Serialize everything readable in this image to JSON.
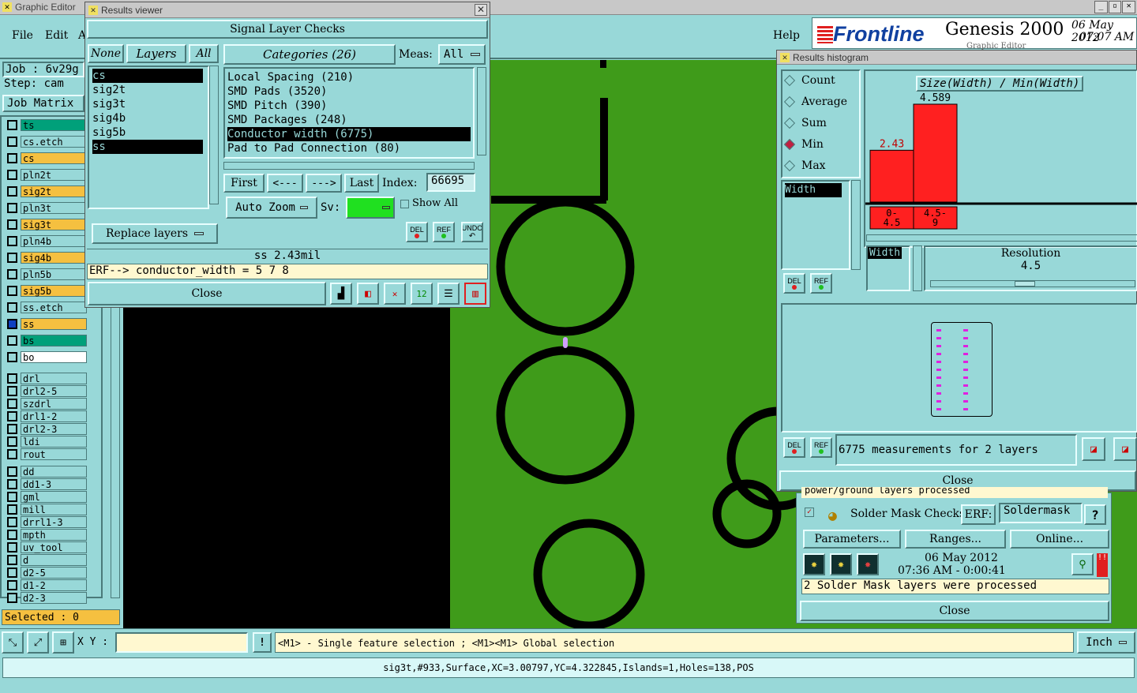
{
  "app": {
    "title": "Graphic Editor",
    "menu": [
      "File",
      "Edit",
      "A"
    ],
    "help": "Help"
  },
  "brand": {
    "logo": "Frontline",
    "product": "Genesis 2000",
    "date": "06 May 2012",
    "time": "07:07 AM",
    "sub": "Graphic Editor"
  },
  "job": {
    "job_label": "Job : 6v29g",
    "step_label": "Step: cam",
    "job_matrix": "Job Matrix"
  },
  "layers": [
    {
      "name": "ts",
      "color": "green"
    },
    {
      "name": "cs.etch",
      "color": "teal"
    },
    {
      "name": "cs",
      "color": "yellow"
    },
    {
      "name": "pln2t",
      "color": "teal"
    },
    {
      "name": "sig2t",
      "color": "yellow"
    },
    {
      "name": "pln3t",
      "color": "teal"
    },
    {
      "name": "sig3t",
      "color": "yellow"
    },
    {
      "name": "pln4b",
      "color": "teal"
    },
    {
      "name": "sig4b",
      "color": "yellow"
    },
    {
      "name": "pln5b",
      "color": "teal"
    },
    {
      "name": "sig5b",
      "color": "yellow"
    },
    {
      "name": "ss.etch",
      "color": "teal"
    },
    {
      "name": "ss",
      "color": "yellow"
    },
    {
      "name": "bs",
      "color": "green"
    },
    {
      "name": "bo",
      "color": "white"
    },
    {
      "name": "drl",
      "color": "teal"
    },
    {
      "name": "drl2-5",
      "color": "teal"
    },
    {
      "name": "szdrl",
      "color": "teal"
    },
    {
      "name": "drl1-2",
      "color": "teal"
    },
    {
      "name": "drl2-3",
      "color": "teal"
    },
    {
      "name": "ldi",
      "color": "teal"
    },
    {
      "name": "rout",
      "color": "teal"
    },
    {
      "name": "dd",
      "color": "teal"
    },
    {
      "name": "dd1-3",
      "color": "teal"
    },
    {
      "name": "gml",
      "color": "teal"
    },
    {
      "name": "mill",
      "color": "teal"
    },
    {
      "name": "drrl1-3",
      "color": "teal"
    },
    {
      "name": "mpth",
      "color": "teal"
    },
    {
      "name": "uv_tool",
      "color": "teal"
    },
    {
      "name": "d",
      "color": "teal"
    },
    {
      "name": "d2-5",
      "color": "teal"
    },
    {
      "name": "d1-2",
      "color": "teal"
    },
    {
      "name": "d2-3",
      "color": "teal"
    }
  ],
  "selected": "Selected : 0",
  "results_viewer": {
    "title": "Results viewer",
    "header": "Signal Layer Checks",
    "none": "None",
    "layers_tab": "Layers",
    "all": "All",
    "layer_list": [
      "cs",
      "sig2t",
      "sig3t",
      "sig4b",
      "sig5b",
      "ss"
    ],
    "categories_label": "Categories (26)",
    "meas_label": "Meas:",
    "meas_value": "All",
    "categories": [
      "Local Spacing (210)",
      "SMD Pads (3520)",
      "SMD Pitch (390)",
      "SMD Packages (248)",
      "Conductor width (6775)",
      "Pad to Pad Connection (80)"
    ],
    "first": "First",
    "prev": "<---",
    "next": "--->",
    "last": "Last",
    "index_label": "Index:",
    "index_value": "66695",
    "autozoom": "Auto Zoom",
    "sv": "Sv:",
    "show_all": "Show All",
    "replace": "Replace layers",
    "del": "DEL",
    "ref": "REF",
    "undo": "UNDO",
    "status": "ss 2.43mil",
    "erf": "ERF--> conductor_width = 5 7 8",
    "close": "Close"
  },
  "histogram": {
    "title": "Results histogram",
    "options": [
      "Count",
      "Average",
      "Sum",
      "Min",
      "Max"
    ],
    "selected_option": "Min",
    "chart_title": "Size(Width) / Min(Width)",
    "chart_data": {
      "type": "bar",
      "categories": [
        "0-4.5",
        "4.5-9"
      ],
      "values": [
        2.43,
        4.589
      ],
      "title": "Size(Width) / Min(Width)"
    },
    "bar_labels": [
      "2.43",
      "4.589"
    ],
    "bin_labels": [
      "0-\n4.5",
      "4.5-\n9"
    ],
    "list_item": "Width",
    "width_label": "Width",
    "resolution_label": "Resolution",
    "resolution_value": "4.5",
    "measurements": "6775 measurements for 2 layers",
    "close": "Close",
    "accent": "#ff2020"
  },
  "solder": {
    "partial": "power/ground layers processed",
    "title": "Solder Mask Checks",
    "erf": "ERF:",
    "erf_value": "Soldermask",
    "help": "?",
    "parameters": "Parameters...",
    "ranges": "Ranges...",
    "online": "Online...",
    "date": "06 May 2012",
    "time": "07:36 AM - 0:00:41",
    "status": "2 Solder Mask layers were processed",
    "close": "Close"
  },
  "bottom": {
    "xy": "X Y :",
    "hint": "<M1> - Single feature selection ; <M1><M1> Global selection",
    "units": "Inch",
    "status": "sig3t,#933,Surface,XC=3.00797,YC=4.322845,Islands=1,Holes=138,POS"
  }
}
